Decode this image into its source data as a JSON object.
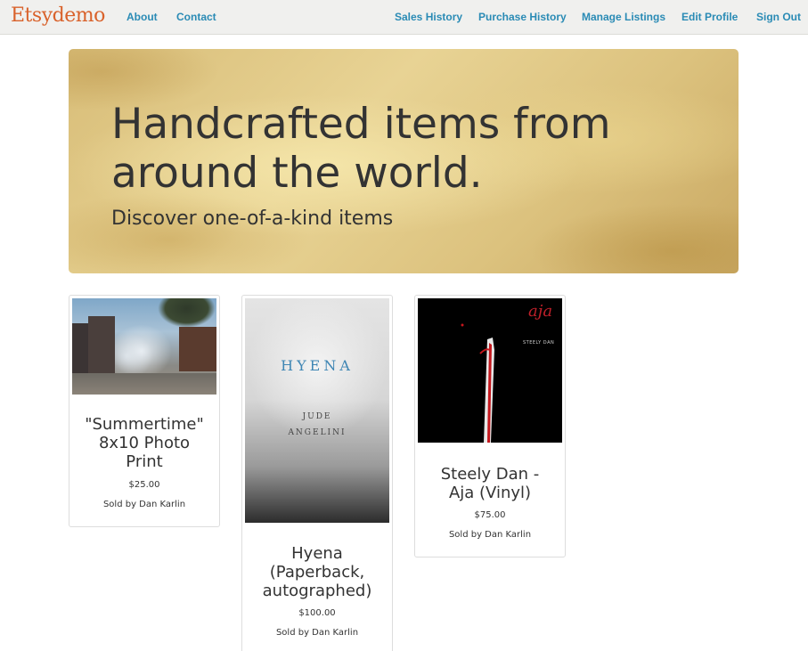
{
  "nav": {
    "brand": "Etsydemo",
    "left_links": [
      "About",
      "Contact"
    ],
    "right_links": [
      "Sales History",
      "Purchase History",
      "Manage Listings",
      "Edit Profile",
      "Sign Out"
    ]
  },
  "hero": {
    "title_line1": "Handcrafted items from",
    "title_line2": "around the world.",
    "subtitle": "Discover one-of-a-kind items"
  },
  "listings": [
    {
      "title_lines": [
        "\"Summertime\"",
        "8x10 Photo",
        "Print"
      ],
      "price": "$25.00",
      "seller": "Sold by Dan Karlin"
    },
    {
      "title_lines": [
        "Hyena",
        "(Paperback,",
        "autographed)"
      ],
      "price": "$100.00",
      "seller": "Sold by Dan Karlin",
      "cover_title": "HYENA",
      "cover_author_line1": "JUDE",
      "cover_author_line2": "ANGELINI"
    },
    {
      "title_lines": [
        "Steely Dan -",
        "Aja (Vinyl)"
      ],
      "price": "$75.00",
      "seller": "Sold by Dan Karlin",
      "cover_title": "aja",
      "cover_artist": "STEELY DAN"
    }
  ],
  "colors": {
    "brand": "#d9622b",
    "link": "#2a8bb5",
    "text": "#333333",
    "nav_bg": "#f0f0ee"
  }
}
